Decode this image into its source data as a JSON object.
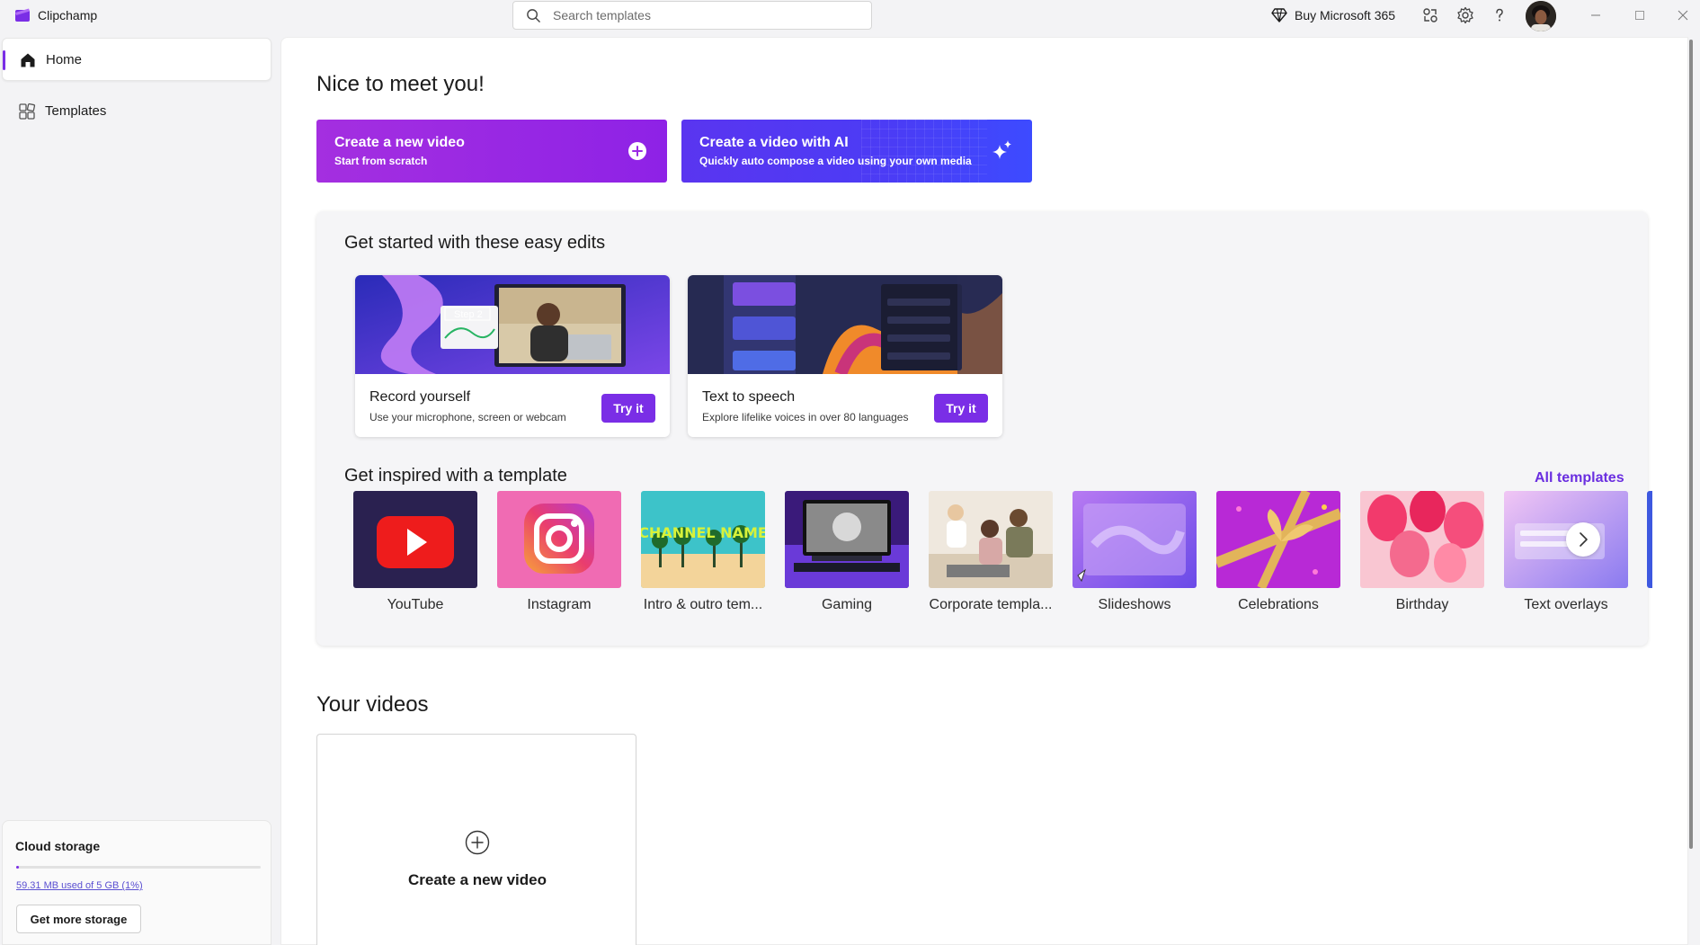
{
  "app": {
    "title": "Clipchamp",
    "accent_color": "#7a2ee6"
  },
  "search": {
    "placeholder": "Search templates"
  },
  "titlebar": {
    "buy_label": "Buy Microsoft 365",
    "icons": [
      "diamond-icon",
      "share-icon",
      "settings-icon",
      "help-icon",
      "avatar",
      "minimize-icon",
      "maximize-icon",
      "close-icon"
    ]
  },
  "sidebar": {
    "items": [
      {
        "label": "Home",
        "icon": "home-icon",
        "active": true
      },
      {
        "label": "Templates",
        "icon": "templates-icon",
        "active": false
      }
    ],
    "storage": {
      "title": "Cloud storage",
      "usage_text": "59.31 MB used of 5 GB (1%)",
      "percent_used": 1,
      "button_label": "Get more storage"
    }
  },
  "main": {
    "greeting": "Nice to meet you!",
    "hero_cards": [
      {
        "title": "Create a new video",
        "subtitle": "Start from scratch",
        "icon": "plus-circle-icon"
      },
      {
        "title": "Create a video with AI",
        "subtitle": "Quickly auto compose a video using your own media",
        "icon": "sparkle-icon"
      }
    ],
    "easy_edits": {
      "title": "Get started with these easy edits",
      "cards": [
        {
          "title": "Record yourself",
          "subtitle": "Use your microphone, screen or webcam",
          "button": "Try it",
          "thumb_tag": "Step 2"
        },
        {
          "title": "Text to speech",
          "subtitle": "Explore lifelike voices in over 80 languages",
          "button": "Try it"
        }
      ]
    },
    "templates": {
      "title": "Get inspired with a template",
      "all_link": "All templates",
      "items": [
        {
          "label": "YouTube"
        },
        {
          "label": "Instagram"
        },
        {
          "label": "Intro & outro tem...",
          "thumb_text": "CHANNEL NAME"
        },
        {
          "label": "Gaming"
        },
        {
          "label": "Corporate templa..."
        },
        {
          "label": "Slideshows"
        },
        {
          "label": "Celebrations"
        },
        {
          "label": "Birthday"
        },
        {
          "label": "Text overlays"
        }
      ]
    },
    "videos": {
      "title": "Your videos",
      "new_card_label": "Create a new video"
    }
  }
}
